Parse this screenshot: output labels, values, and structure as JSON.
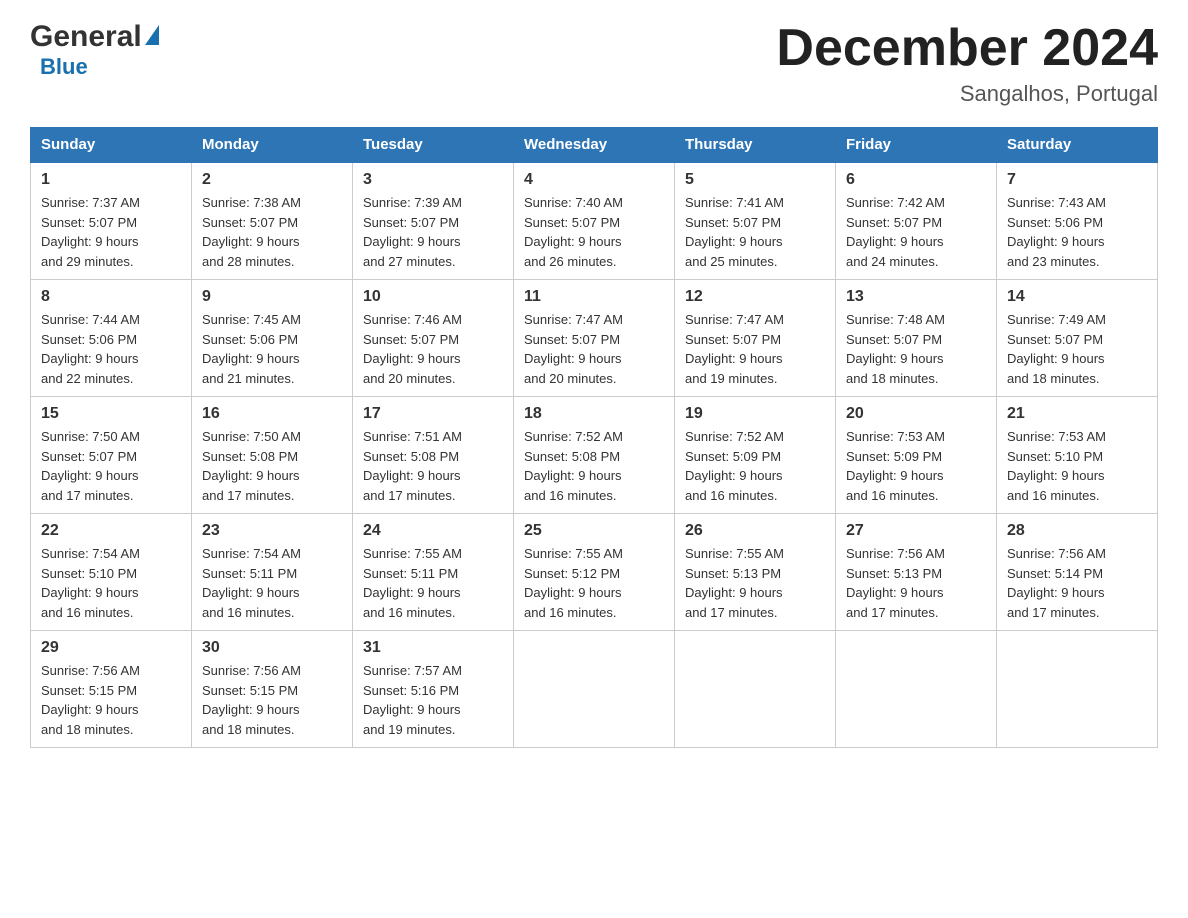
{
  "header": {
    "logo_general": "General",
    "logo_blue": "Blue",
    "month_title": "December 2024",
    "location": "Sangalhos, Portugal"
  },
  "days_of_week": [
    "Sunday",
    "Monday",
    "Tuesday",
    "Wednesday",
    "Thursday",
    "Friday",
    "Saturday"
  ],
  "weeks": [
    [
      {
        "day": "1",
        "sunrise": "7:37 AM",
        "sunset": "5:07 PM",
        "daylight": "9 hours and 29 minutes."
      },
      {
        "day": "2",
        "sunrise": "7:38 AM",
        "sunset": "5:07 PM",
        "daylight": "9 hours and 28 minutes."
      },
      {
        "day": "3",
        "sunrise": "7:39 AM",
        "sunset": "5:07 PM",
        "daylight": "9 hours and 27 minutes."
      },
      {
        "day": "4",
        "sunrise": "7:40 AM",
        "sunset": "5:07 PM",
        "daylight": "9 hours and 26 minutes."
      },
      {
        "day": "5",
        "sunrise": "7:41 AM",
        "sunset": "5:07 PM",
        "daylight": "9 hours and 25 minutes."
      },
      {
        "day": "6",
        "sunrise": "7:42 AM",
        "sunset": "5:07 PM",
        "daylight": "9 hours and 24 minutes."
      },
      {
        "day": "7",
        "sunrise": "7:43 AM",
        "sunset": "5:06 PM",
        "daylight": "9 hours and 23 minutes."
      }
    ],
    [
      {
        "day": "8",
        "sunrise": "7:44 AM",
        "sunset": "5:06 PM",
        "daylight": "9 hours and 22 minutes."
      },
      {
        "day": "9",
        "sunrise": "7:45 AM",
        "sunset": "5:06 PM",
        "daylight": "9 hours and 21 minutes."
      },
      {
        "day": "10",
        "sunrise": "7:46 AM",
        "sunset": "5:07 PM",
        "daylight": "9 hours and 20 minutes."
      },
      {
        "day": "11",
        "sunrise": "7:47 AM",
        "sunset": "5:07 PM",
        "daylight": "9 hours and 20 minutes."
      },
      {
        "day": "12",
        "sunrise": "7:47 AM",
        "sunset": "5:07 PM",
        "daylight": "9 hours and 19 minutes."
      },
      {
        "day": "13",
        "sunrise": "7:48 AM",
        "sunset": "5:07 PM",
        "daylight": "9 hours and 18 minutes."
      },
      {
        "day": "14",
        "sunrise": "7:49 AM",
        "sunset": "5:07 PM",
        "daylight": "9 hours and 18 minutes."
      }
    ],
    [
      {
        "day": "15",
        "sunrise": "7:50 AM",
        "sunset": "5:07 PM",
        "daylight": "9 hours and 17 minutes."
      },
      {
        "day": "16",
        "sunrise": "7:50 AM",
        "sunset": "5:08 PM",
        "daylight": "9 hours and 17 minutes."
      },
      {
        "day": "17",
        "sunrise": "7:51 AM",
        "sunset": "5:08 PM",
        "daylight": "9 hours and 17 minutes."
      },
      {
        "day": "18",
        "sunrise": "7:52 AM",
        "sunset": "5:08 PM",
        "daylight": "9 hours and 16 minutes."
      },
      {
        "day": "19",
        "sunrise": "7:52 AM",
        "sunset": "5:09 PM",
        "daylight": "9 hours and 16 minutes."
      },
      {
        "day": "20",
        "sunrise": "7:53 AM",
        "sunset": "5:09 PM",
        "daylight": "9 hours and 16 minutes."
      },
      {
        "day": "21",
        "sunrise": "7:53 AM",
        "sunset": "5:10 PM",
        "daylight": "9 hours and 16 minutes."
      }
    ],
    [
      {
        "day": "22",
        "sunrise": "7:54 AM",
        "sunset": "5:10 PM",
        "daylight": "9 hours and 16 minutes."
      },
      {
        "day": "23",
        "sunrise": "7:54 AM",
        "sunset": "5:11 PM",
        "daylight": "9 hours and 16 minutes."
      },
      {
        "day": "24",
        "sunrise": "7:55 AM",
        "sunset": "5:11 PM",
        "daylight": "9 hours and 16 minutes."
      },
      {
        "day": "25",
        "sunrise": "7:55 AM",
        "sunset": "5:12 PM",
        "daylight": "9 hours and 16 minutes."
      },
      {
        "day": "26",
        "sunrise": "7:55 AM",
        "sunset": "5:13 PM",
        "daylight": "9 hours and 17 minutes."
      },
      {
        "day": "27",
        "sunrise": "7:56 AM",
        "sunset": "5:13 PM",
        "daylight": "9 hours and 17 minutes."
      },
      {
        "day": "28",
        "sunrise": "7:56 AM",
        "sunset": "5:14 PM",
        "daylight": "9 hours and 17 minutes."
      }
    ],
    [
      {
        "day": "29",
        "sunrise": "7:56 AM",
        "sunset": "5:15 PM",
        "daylight": "9 hours and 18 minutes."
      },
      {
        "day": "30",
        "sunrise": "7:56 AM",
        "sunset": "5:15 PM",
        "daylight": "9 hours and 18 minutes."
      },
      {
        "day": "31",
        "sunrise": "7:57 AM",
        "sunset": "5:16 PM",
        "daylight": "9 hours and 19 minutes."
      },
      null,
      null,
      null,
      null
    ]
  ],
  "labels": {
    "sunrise": "Sunrise:",
    "sunset": "Sunset:",
    "daylight": "Daylight:"
  }
}
